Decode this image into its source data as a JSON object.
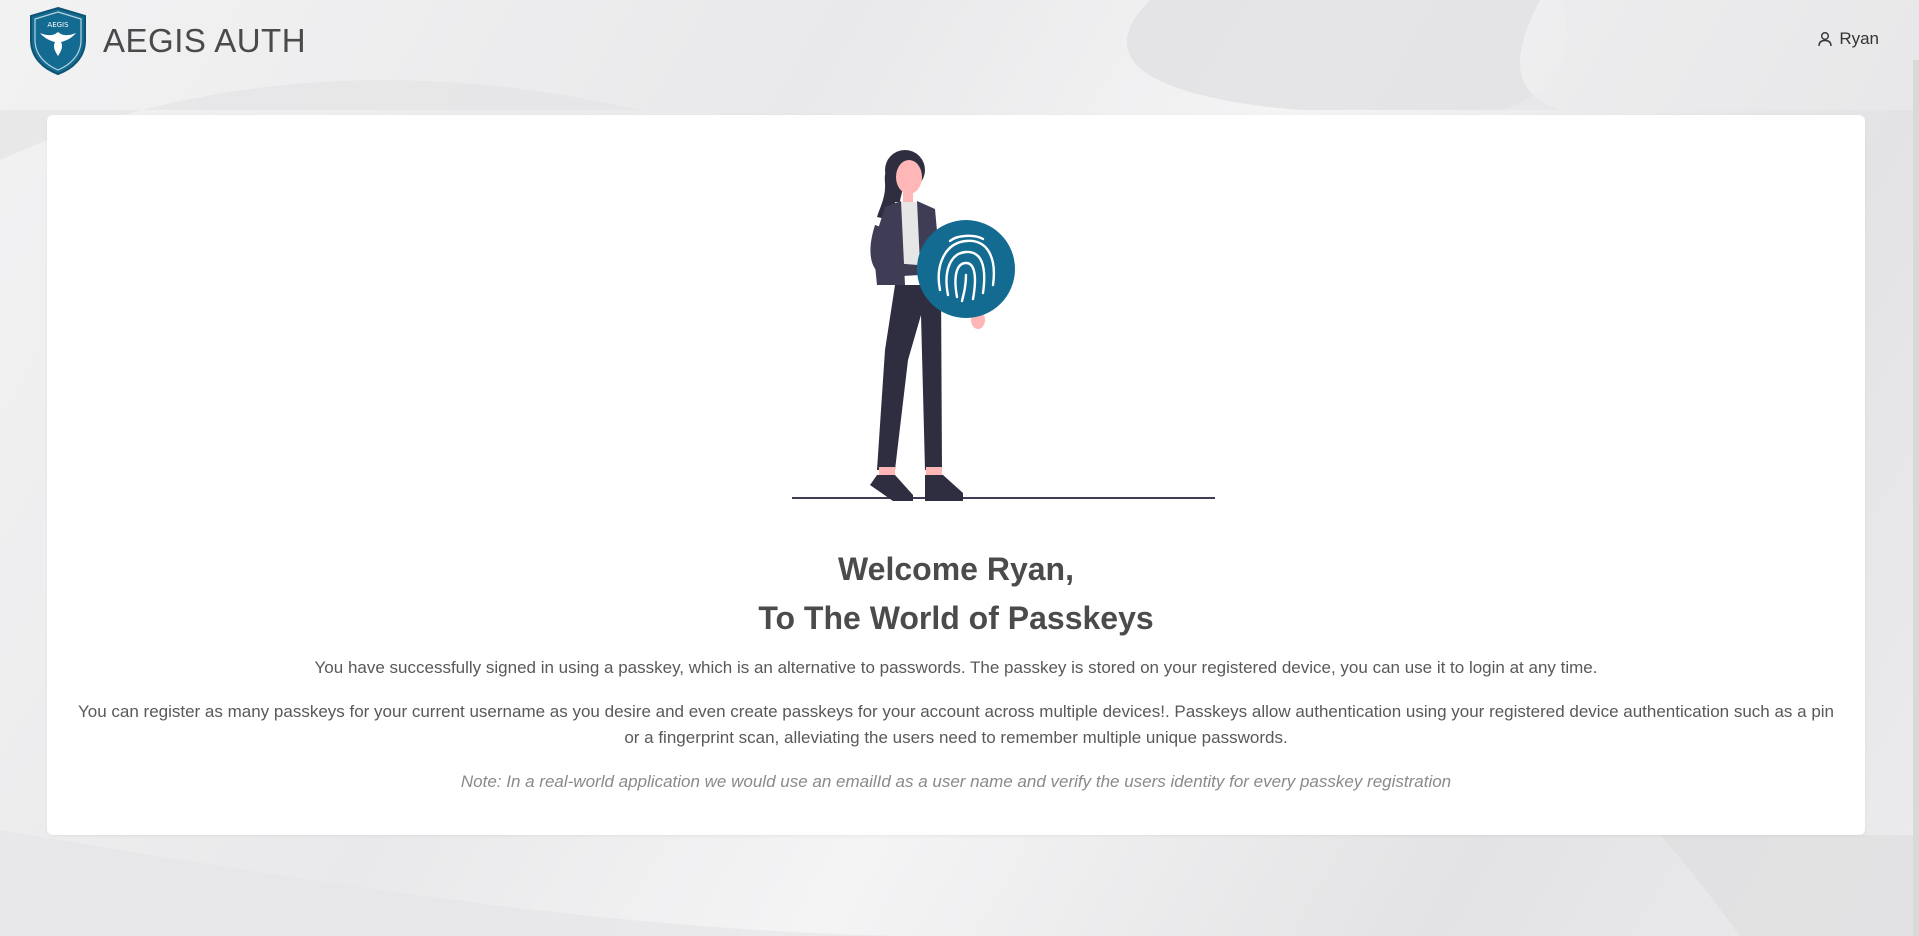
{
  "header": {
    "brand_name": "AEGIS AUTH",
    "logo_text": "AEGIS",
    "user_name": "Ryan"
  },
  "icons": {
    "logo": "eagle-shield-logo",
    "user": "user-icon",
    "illustration": "woman-holding-fingerprint-illustration"
  },
  "colors": {
    "accent": "#136b91",
    "text": "#4b4b4b"
  },
  "main": {
    "welcome_line1": "Welcome Ryan,",
    "welcome_line2": "To The World of Passkeys",
    "paragraph1": "You have successfully signed in using a passkey, which is an alternative to passwords. The passkey is stored on your registered device, you can use it to login at any time.",
    "paragraph2": "You can register as many passkeys for your current username as you desire and even create passkeys for your account across multiple devices!. Passkeys allow authentication using your registered device authentication such as a pin or a fingerprint scan, alleviating the users need to remember multiple unique passwords.",
    "note": "Note: In a real-world application we would use an emailId as a user name and verify the users identity for every passkey registration"
  }
}
